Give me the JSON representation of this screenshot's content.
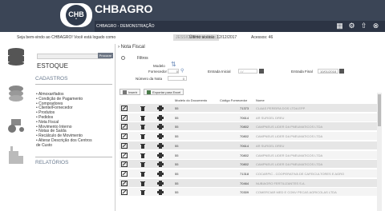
{
  "app": {
    "brand": "CHBAGRO",
    "logo": "CHB",
    "subtitle": "CHBAGRO - DEMONSTRAÇÃO"
  },
  "welcome": {
    "text": "Seja bem-vindo ao CHBAGRO! Você está logado como",
    "user": "JESSICA PINHA DIG...",
    "last_access_label": "Último acesso: 12/12/2017",
    "accesses": "Acessos: 46"
  },
  "sidebar": {
    "search_button": "Procurar",
    "title": "ESTOQUE",
    "cadastros": "CADASTROS",
    "relatorios": "RELATÓRIOS",
    "items": [
      "Almoxarifados",
      "Condição de Pagamento",
      "Compradores",
      "Cliente/Fornecedor",
      "Produtos",
      "Pedidos",
      "Nota Fiscal",
      "Movimento Interno",
      "Notas de Saída",
      "Recálculo de Movimento",
      "Alterar Descrição dos Centros",
      "de Custo"
    ]
  },
  "main": {
    "breadcrumb": "Nota Fiscal",
    "filtros": "Filtros",
    "modelo_label": "Modelo",
    "fornecedor_label": "Fornecedor",
    "numero_label": "Número da Nota",
    "numero_value": "0",
    "fornecedor_value": "0",
    "entrada_inicial_label": "Entrada Inicial",
    "entrada_inicial_value": "/ /",
    "entrada_final_label": "Entrada Final",
    "entrada_final_value": "10/01/2018",
    "inserir": "Inserir",
    "exportar": "Exportar para Excel",
    "headers": [
      "Modelo do Documento",
      "Código Fornecedor",
      "Nome"
    ],
    "rows": [
      {
        "modelo": "55",
        "codigo": "71373",
        "nome": "CLAAS PEREIRA DOS LTDA EPP"
      },
      {
        "modelo": "55",
        "codigo": "70614",
        "nome": "AR SURGEL DREU"
      },
      {
        "modelo": "55",
        "codigo": "70802",
        "nome": "CAMPNEUS LIDER DA PNEUMATICOS LTDA"
      },
      {
        "modelo": "55",
        "codigo": "70802",
        "nome": "CAMPNEUS LIDER DA PNEUMATICOS LTDA"
      },
      {
        "modelo": "55",
        "codigo": "70614",
        "nome": "AR SURGEL DREU"
      },
      {
        "modelo": "55",
        "codigo": "70802",
        "nome": "CAMPNEUS LIDER DA PNEUMATICOS LTDA"
      },
      {
        "modelo": "55",
        "codigo": "70802",
        "nome": "CAMPNEUS LIDER DA PNEUMATICOS LTDA"
      },
      {
        "modelo": "55",
        "codigo": "71318",
        "nome": "COCARPIC - COOPERATIVA DE CAFEICULTORES E AGRO"
      },
      {
        "modelo": "55",
        "codigo": "70464",
        "nome": "NUBIAGRO FERTILIZANTES S.A."
      },
      {
        "modelo": "55",
        "codigo": "70309",
        "nome": "COMERCIAR MED E CONV PECAS AGRICOLAS LTDA"
      }
    ]
  }
}
